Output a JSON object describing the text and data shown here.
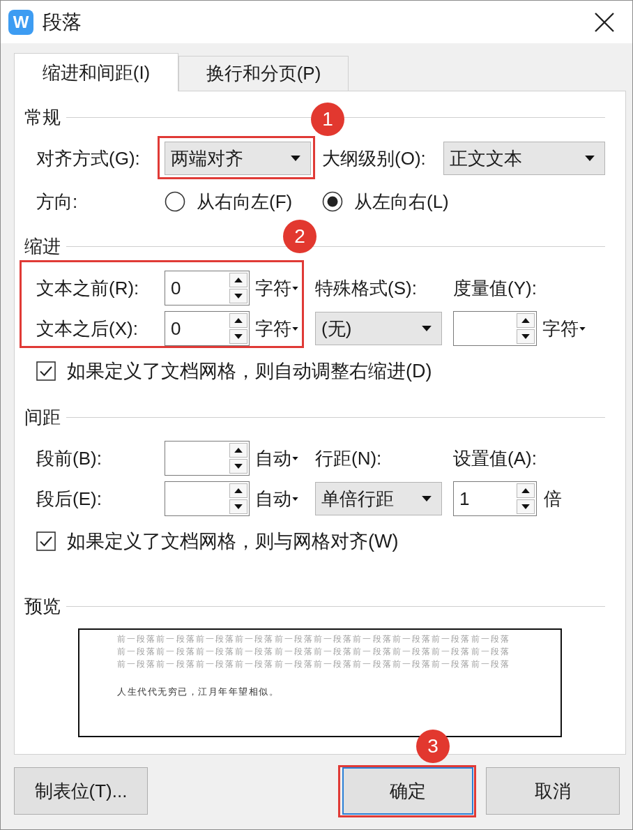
{
  "window": {
    "logo": "W",
    "title": "段落"
  },
  "tabs": [
    {
      "label": "缩进和间距(I)",
      "selected": true
    },
    {
      "label": "换行和分页(P)",
      "selected": false
    }
  ],
  "general": {
    "heading": "常规",
    "alignment": {
      "label": "对齐方式(G):",
      "value": "两端对齐",
      "callout": "1"
    },
    "outline_level": {
      "label": "大纲级别(O):",
      "value": "正文文本"
    },
    "direction": {
      "label": "方向:",
      "options": [
        {
          "label": "从右向左(F)",
          "selected": false
        },
        {
          "label": "从左向右(L)",
          "selected": true
        }
      ]
    }
  },
  "indent": {
    "heading": "缩进",
    "callout": "2",
    "before": {
      "label": "文本之前(R):",
      "value": "0",
      "unit": {
        "label": "字符",
        "menu": true
      }
    },
    "after": {
      "label": "文本之后(X):",
      "value": "0",
      "unit": {
        "label": "字符",
        "menu": true
      }
    },
    "special": {
      "label": "特殊格式(S):",
      "value": "(无)"
    },
    "by": {
      "label": "度量值(Y):",
      "unit": {
        "label": "字符",
        "menu": true
      }
    },
    "grid_option": {
      "label": "如果定义了文档网格，则自动调整右缩进(D)",
      "checked": true
    }
  },
  "spacing": {
    "heading": "间距",
    "before": {
      "label": "段前(B):",
      "unit": {
        "label": "自动",
        "menu": true
      }
    },
    "after": {
      "label": "段后(E):",
      "unit": {
        "label": "自动",
        "menu": true
      }
    },
    "line_spacing": {
      "label": "行距(N):",
      "value": "单倍行距"
    },
    "at": {
      "label": "设置值(A):",
      "value": "1",
      "unit": {
        "label": "倍",
        "menu": false
      }
    },
    "grid_option": {
      "label": "如果定义了文档网格，则与网格对齐(W)",
      "checked": true
    }
  },
  "preview": {
    "heading": "预览",
    "previous_lines": [
      "前一段落前一段落前一段落前一段落前一段落前一段落前一段落前一段落前一段落前一段落",
      "前一段落前一段落前一段落前一段落前一段落前一段落前一段落前一段落前一段落前一段落",
      "前一段落前一段落前一段落前一段落前一段落前一段落前一段落前一段落前一段落前一段落"
    ],
    "sample": "人生代代无穷已，江月年年望相似。"
  },
  "buttons": [
    {
      "label": "制表位(T)...",
      "default": false
    },
    {
      "label": "确定",
      "default": true,
      "callout": "3"
    },
    {
      "label": "取消",
      "default": false
    }
  ]
}
